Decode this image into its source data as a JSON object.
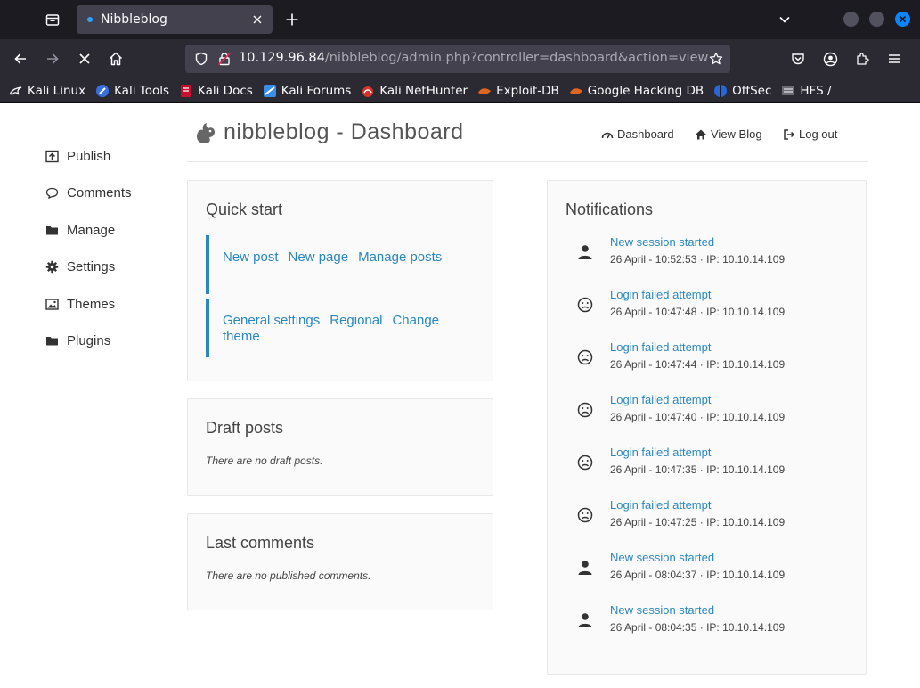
{
  "browser": {
    "tab": {
      "title": "Nibbleblog"
    },
    "url": {
      "host": "10.129.96.84",
      "path": "/nibbleblog/admin.php?controller=dashboard&action=view"
    },
    "bookmarks": [
      {
        "label": "Kali Linux",
        "icon": "kali-dragon-icon"
      },
      {
        "label": "Kali Tools",
        "icon": "kali-tools-icon"
      },
      {
        "label": "Kali Docs",
        "icon": "kali-docs-icon"
      },
      {
        "label": "Kali Forums",
        "icon": "kali-forums-icon"
      },
      {
        "label": "Kali NetHunter",
        "icon": "kali-nethunter-icon"
      },
      {
        "label": "Exploit-DB",
        "icon": "exploit-db-icon"
      },
      {
        "label": "Google Hacking DB",
        "icon": "ghdb-icon"
      },
      {
        "label": "OffSec",
        "icon": "offsec-icon"
      },
      {
        "label": "HFS /",
        "icon": "hfs-icon"
      }
    ]
  },
  "sidebar": {
    "items": [
      {
        "label": "Publish",
        "icon": "publish-icon"
      },
      {
        "label": "Comments",
        "icon": "comment-icon"
      },
      {
        "label": "Manage",
        "icon": "folder-icon"
      },
      {
        "label": "Settings",
        "icon": "gear-icon"
      },
      {
        "label": "Themes",
        "icon": "image-icon"
      },
      {
        "label": "Plugins",
        "icon": "folder-icon"
      }
    ]
  },
  "header": {
    "title": "nibbleblog - Dashboard",
    "links": [
      {
        "label": "Dashboard",
        "icon": "dashboard-icon"
      },
      {
        "label": "View Blog",
        "icon": "home-icon"
      },
      {
        "label": "Log out",
        "icon": "logout-icon"
      }
    ]
  },
  "quick_start": {
    "title": "Quick start",
    "group1": {
      "new_post": "New post",
      "new_page": "New page",
      "manage_posts": "Manage posts"
    },
    "group2": {
      "general_settings": "General settings",
      "regional": "Regional",
      "change_theme": "Change theme"
    }
  },
  "draft_posts": {
    "title": "Draft posts",
    "empty": "There are no draft posts."
  },
  "last_comments": {
    "title": "Last comments",
    "empty": "There are no published comments."
  },
  "notifications": {
    "title": "Notifications",
    "items": [
      {
        "title": "New session started",
        "meta": "26 April - 10:52:53 · IP: 10.10.14.109",
        "icon": "user-icon"
      },
      {
        "title": "Login failed attempt",
        "meta": "26 April - 10:47:48 · IP: 10.10.14.109",
        "icon": "frown-icon"
      },
      {
        "title": "Login failed attempt",
        "meta": "26 April - 10:47:44 · IP: 10.10.14.109",
        "icon": "frown-icon"
      },
      {
        "title": "Login failed attempt",
        "meta": "26 April - 10:47:40 · IP: 10.10.14.109",
        "icon": "frown-icon"
      },
      {
        "title": "Login failed attempt",
        "meta": "26 April - 10:47:35 · IP: 10.10.14.109",
        "icon": "frown-icon"
      },
      {
        "title": "Login failed attempt",
        "meta": "26 April - 10:47:25 · IP: 10.10.14.109",
        "icon": "frown-icon"
      },
      {
        "title": "New session started",
        "meta": "26 April - 08:04:37 · IP: 10.10.14.109",
        "icon": "user-icon"
      },
      {
        "title": "New session started",
        "meta": "26 April - 08:04:35 · IP: 10.10.14.109",
        "icon": "user-icon"
      }
    ]
  },
  "colors": {
    "link": "#2a88c0",
    "chrome_dark": "#1c1b22",
    "toolbar": "#2b2a33",
    "accent": "#0b84ff"
  }
}
